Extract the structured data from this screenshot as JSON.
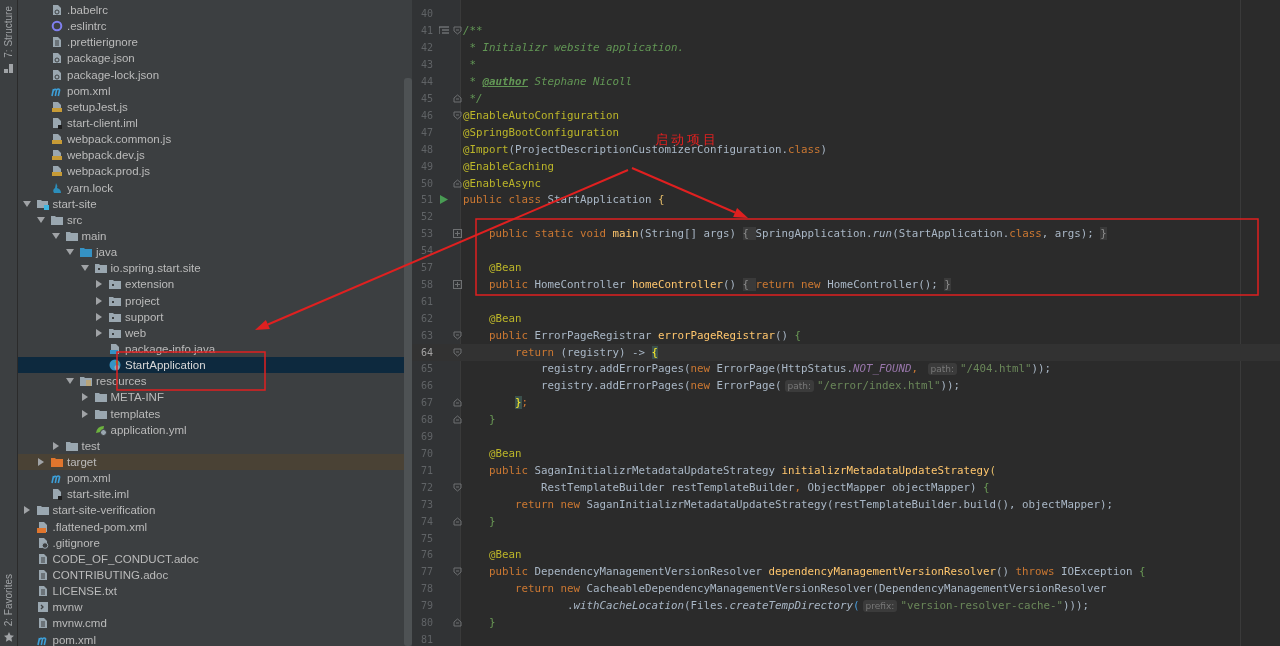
{
  "tool_strip": {
    "top_tab": "7: Structure",
    "bottom_tab": "2: Favorites"
  },
  "tree": [
    {
      "children": [
        {
          "name": ".babelrc",
          "kind": "config",
          "selected": false
        },
        {
          "name": ".eslintrc",
          "kind": "eslint",
          "selected": false
        },
        {
          "name": ".prettierignore",
          "kind": "text",
          "selected": false
        },
        {
          "name": "package.json",
          "kind": "config",
          "selected": false
        },
        {
          "name": "package-lock.json",
          "kind": "config",
          "selected": false
        },
        {
          "name": "pom.xml",
          "kind": "maven",
          "selected": false
        },
        {
          "name": "setupJest.js",
          "kind": "js",
          "selected": false
        },
        {
          "name": "start-client.iml",
          "kind": "iml",
          "selected": false
        },
        {
          "name": "webpack.common.js",
          "kind": "js",
          "selected": false
        },
        {
          "name": "webpack.dev.js",
          "kind": "js",
          "selected": false
        },
        {
          "name": "webpack.prod.js",
          "kind": "js",
          "selected": false
        },
        {
          "name": "yarn.lock",
          "kind": "yarn",
          "selected": false
        }
      ]
    },
    {
      "name": "start-site",
      "kind": "module",
      "expanded": true,
      "selected": false,
      "children": [
        {
          "name": "src",
          "kind": "folder",
          "expanded": true,
          "selected": false,
          "children": [
            {
              "name": "main",
              "kind": "folder",
              "expanded": true,
              "selected": false,
              "children": [
                {
                  "name": "java",
                  "kind": "source-folder",
                  "expanded": true,
                  "selected": false,
                  "children": [
                    {
                      "name": "io.spring.start.site",
                      "kind": "package",
                      "expanded": true,
                      "selected": false,
                      "children": [
                        {
                          "name": "extension",
                          "kind": "package",
                          "expanded": false,
                          "selected": false
                        },
                        {
                          "name": "project",
                          "kind": "package",
                          "expanded": false,
                          "selected": false
                        },
                        {
                          "name": "support",
                          "kind": "package",
                          "expanded": false,
                          "selected": false
                        },
                        {
                          "name": "web",
                          "kind": "package",
                          "expanded": false,
                          "selected": false
                        },
                        {
                          "name": "package-info.java",
                          "kind": "java-file",
                          "selected": false
                        },
                        {
                          "name": "StartApplication",
                          "kind": "spring-class",
                          "selected": true
                        }
                      ]
                    }
                  ]
                },
                {
                  "name": "resources",
                  "kind": "resources",
                  "expanded": true,
                  "selected": false,
                  "children": [
                    {
                      "name": "META-INF",
                      "kind": "folder",
                      "expanded": false,
                      "selected": false
                    },
                    {
                      "name": "templates",
                      "kind": "folder",
                      "expanded": false,
                      "selected": false
                    },
                    {
                      "name": "application.yml",
                      "kind": "yml",
                      "selected": false
                    }
                  ]
                }
              ]
            },
            {
              "name": "test",
              "kind": "folder",
              "expanded": false,
              "selected": false
            }
          ]
        },
        {
          "name": "target",
          "kind": "excluded-folder",
          "expanded": false,
          "selected": false
        },
        {
          "name": "pom.xml",
          "kind": "maven",
          "selected": false
        },
        {
          "name": "start-site.iml",
          "kind": "iml",
          "selected": false
        }
      ]
    },
    {
      "name": "start-site-verification",
      "kind": "folder",
      "expanded": false,
      "selected": false
    },
    {
      "name": ".flattened-pom.xml",
      "kind": "xml",
      "selected": false
    },
    {
      "name": ".gitignore",
      "kind": "gitignore",
      "selected": false
    },
    {
      "name": "CODE_OF_CONDUCT.adoc",
      "kind": "text",
      "selected": false
    },
    {
      "name": "CONTRIBUTING.adoc",
      "kind": "text",
      "selected": false
    },
    {
      "name": "LICENSE.txt",
      "kind": "text",
      "selected": false
    },
    {
      "name": "mvnw",
      "kind": "script",
      "selected": false
    },
    {
      "name": "mvnw.cmd",
      "kind": "text",
      "selected": false
    },
    {
      "name": "pom.xml",
      "kind": "maven",
      "selected": false
    }
  ],
  "code": {
    "lines": [
      {
        "number": "40",
        "current": false
      },
      {
        "number": "41",
        "current": false,
        "fold_start": true,
        "doc": true,
        "tokens": [
          {
            "text": "/**",
            "kind": "doc"
          }
        ]
      },
      {
        "number": "42",
        "current": false,
        "tokens": [
          {
            "text": " * Initializr website application.",
            "kind": "doc"
          }
        ]
      },
      {
        "number": "43",
        "current": false,
        "tokens": [
          {
            "text": " *",
            "kind": "doc"
          }
        ]
      },
      {
        "number": "44",
        "current": false,
        "tokens": [
          {
            "text": " * ",
            "kind": "doc"
          },
          {
            "text": "@author",
            "kind": "doctag"
          },
          {
            "text": " Stephane Nicoll",
            "kind": "doc"
          }
        ]
      },
      {
        "number": "45",
        "current": false,
        "fold_end": true,
        "tokens": [
          {
            "text": " */",
            "kind": "doc"
          }
        ]
      },
      {
        "number": "46",
        "current": false,
        "fold_start": true,
        "tokens": [
          {
            "text": "@EnableAutoConfiguration",
            "kind": "ann"
          }
        ]
      },
      {
        "number": "47",
        "current": false,
        "tokens": [
          {
            "text": "@SpringBootConfiguration",
            "kind": "ann"
          }
        ]
      },
      {
        "number": "48",
        "current": false,
        "tokens": [
          {
            "text": "@Import",
            "kind": "ann"
          },
          {
            "text": "(ProjectDescriptionCustomizerConfiguration.",
            "kind": "txt"
          },
          {
            "text": "class",
            "kind": "kw"
          },
          {
            "text": ")",
            "kind": "txt"
          }
        ]
      },
      {
        "number": "49",
        "current": false,
        "tokens": [
          {
            "text": "@EnableCaching",
            "kind": "ann"
          }
        ]
      },
      {
        "number": "50",
        "current": false,
        "fold_end": true,
        "tokens": [
          {
            "text": "@EnableAsync",
            "kind": "ann"
          }
        ]
      },
      {
        "number": "51",
        "current": false,
        "run": true,
        "tokens": [
          {
            "text": "public class ",
            "kind": "kw"
          },
          {
            "text": "StartApplication ",
            "kind": "txt"
          },
          {
            "text": "{",
            "kind": "br2"
          }
        ]
      },
      {
        "number": "52",
        "current": false
      },
      {
        "number": "53",
        "current": false,
        "collapsed": true,
        "tokens": [
          {
            "text": "    public static void ",
            "kind": "kw"
          },
          {
            "text": "main",
            "kind": "fn"
          },
          {
            "text": "(String[] args)",
            "kind": "txt"
          },
          {
            "text": " { ",
            "kind": "folded"
          },
          {
            "text": "SpringApplication.",
            "kind": "txt"
          },
          {
            "text": "run",
            "kind": "call"
          },
          {
            "text": "(StartApplication.",
            "kind": "txt"
          },
          {
            "text": "class",
            "kind": "kw"
          },
          {
            "text": ", args);",
            "kind": "txt"
          },
          {
            "text": " }",
            "kind": "folded"
          }
        ]
      },
      {
        "number": "54",
        "current": false
      },
      {
        "number": "57",
        "current": false,
        "tokens": [
          {
            "text": "    @Bean",
            "kind": "ann"
          }
        ]
      },
      {
        "number": "58",
        "current": false,
        "collapsed": true,
        "tokens": [
          {
            "text": "    public ",
            "kind": "kw"
          },
          {
            "text": "HomeController ",
            "kind": "txt"
          },
          {
            "text": "homeController",
            "kind": "fn"
          },
          {
            "text": "()",
            "kind": "txt"
          },
          {
            "text": " { ",
            "kind": "folded"
          },
          {
            "text": "return new ",
            "kind": "kw"
          },
          {
            "text": "HomeController();",
            "kind": "txt"
          },
          {
            "text": " }",
            "kind": "folded"
          }
        ]
      },
      {
        "number": "61",
        "current": false
      },
      {
        "number": "62",
        "current": false,
        "tokens": [
          {
            "text": "    @Bean",
            "kind": "ann"
          }
        ]
      },
      {
        "number": "63",
        "current": false,
        "fold_start": true,
        "tokens": [
          {
            "text": "    public ",
            "kind": "kw"
          },
          {
            "text": "ErrorPageRegistrar ",
            "kind": "txt"
          },
          {
            "text": "errorPageRegistrar",
            "kind": "fn"
          },
          {
            "text": "() ",
            "kind": "txt"
          },
          {
            "text": "{",
            "kind": "br1"
          }
        ]
      },
      {
        "number": "64",
        "current": true,
        "fold_start": true,
        "tokens": [
          {
            "text": "        return ",
            "kind": "kw"
          },
          {
            "text": "(registry) -> ",
            "kind": "txt"
          },
          {
            "text": "{",
            "kind": "match"
          }
        ]
      },
      {
        "number": "65",
        "current": false,
        "tokens": [
          {
            "text": "            registry.addErrorPages(",
            "kind": "txt"
          },
          {
            "text": "new ",
            "kind": "kw"
          },
          {
            "text": "ErrorPage(HttpStatus.",
            "kind": "txt"
          },
          {
            "text": "NOT_FOUND",
            "kind": "const"
          },
          {
            "text": ", ",
            "kind": "kw"
          },
          {
            "text": "path:",
            "kind": "hint"
          },
          {
            "text": "\"/404.html\"",
            "kind": "str"
          },
          {
            "text": "));",
            "kind": "txt"
          }
        ]
      },
      {
        "number": "66",
        "current": false,
        "tokens": [
          {
            "text": "            registry.addErrorPages(",
            "kind": "txt"
          },
          {
            "text": "new ",
            "kind": "kw"
          },
          {
            "text": "ErrorPage(",
            "kind": "txt"
          },
          {
            "text": "path:",
            "kind": "hint"
          },
          {
            "text": "\"/error/index.html\"",
            "kind": "str"
          },
          {
            "text": "));",
            "kind": "txt"
          }
        ]
      },
      {
        "number": "67",
        "current": false,
        "fold_end": true,
        "tokens": [
          {
            "text": "        }",
            "kind": "match"
          },
          {
            "text": ";",
            "kind": "kw"
          }
        ]
      },
      {
        "number": "68",
        "current": false,
        "fold_end": true,
        "tokens": [
          {
            "text": "    }",
            "kind": "br1"
          }
        ]
      },
      {
        "number": "69",
        "current": false
      },
      {
        "number": "70",
        "current": false,
        "tokens": [
          {
            "text": "    @Bean",
            "kind": "ann"
          }
        ]
      },
      {
        "number": "71",
        "current": false,
        "tokens": [
          {
            "text": "    public ",
            "kind": "kw"
          },
          {
            "text": "SaganInitializrMetadataUpdateStrategy ",
            "kind": "txt"
          },
          {
            "text": "initializrMetadataUpdateStrategy",
            "kind": "fn"
          },
          {
            "text": "(",
            "kind": "br2"
          }
        ]
      },
      {
        "number": "72",
        "current": false,
        "fold_start": true,
        "tokens": [
          {
            "text": "            RestTemplateBuilder restTemplateBuilder",
            "kind": "txt"
          },
          {
            "text": ", ",
            "kind": "kw"
          },
          {
            "text": "ObjectMapper objectMapper) ",
            "kind": "txt"
          },
          {
            "text": "{",
            "kind": "br1"
          }
        ]
      },
      {
        "number": "73",
        "current": false,
        "tokens": [
          {
            "text": "        return new ",
            "kind": "kw"
          },
          {
            "text": "SaganInitializrMetadataUpdateStrategy(restTemplateBuilder.build(), objectMapper);",
            "kind": "txt"
          }
        ]
      },
      {
        "number": "74",
        "current": false,
        "fold_end": true,
        "tokens": [
          {
            "text": "    }",
            "kind": "br1"
          }
        ]
      },
      {
        "number": "75",
        "current": false
      },
      {
        "number": "76",
        "current": false,
        "tokens": [
          {
            "text": "    @Bean",
            "kind": "ann"
          }
        ]
      },
      {
        "number": "77",
        "current": false,
        "fold_start": true,
        "tokens": [
          {
            "text": "    public ",
            "kind": "kw"
          },
          {
            "text": "DependencyManagementVersionResolver ",
            "kind": "txt"
          },
          {
            "text": "dependencyManagementVersionResolver",
            "kind": "fn"
          },
          {
            "text": "() ",
            "kind": "txt"
          },
          {
            "text": "throws ",
            "kind": "kw"
          },
          {
            "text": "IOException ",
            "kind": "txt"
          },
          {
            "text": "{",
            "kind": "br1"
          }
        ]
      },
      {
        "number": "78",
        "current": false,
        "tokens": [
          {
            "text": "        return new ",
            "kind": "kw"
          },
          {
            "text": "CacheableDependencyManagementVersionResolver(DependencyManagementVersionResolver",
            "kind": "txt"
          }
        ]
      },
      {
        "number": "79",
        "current": false,
        "tokens": [
          {
            "text": "                .",
            "kind": "txt"
          },
          {
            "text": "withCacheLocation",
            "kind": "call"
          },
          {
            "text": "(Files.",
            "kind": "txt"
          },
          {
            "text": "createTempDirectory",
            "kind": "call"
          },
          {
            "text": "(",
            "kind": "br3"
          },
          {
            "text": "prefix:",
            "kind": "hint"
          },
          {
            "text": "\"version-resolver-cache-\"",
            "kind": "str"
          },
          {
            "text": ")));",
            "kind": "txt"
          }
        ]
      },
      {
        "number": "80",
        "current": false,
        "fold_end": true,
        "tokens": [
          {
            "text": "    }",
            "kind": "br1"
          }
        ]
      },
      {
        "number": "81",
        "current": false
      }
    ]
  },
  "annotation": {
    "label": "启动项目"
  }
}
